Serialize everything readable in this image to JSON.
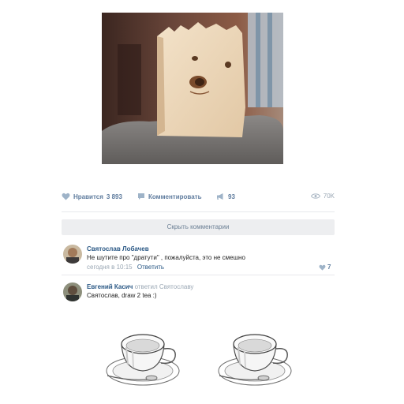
{
  "post": {
    "actions": {
      "like_label": "Нравится",
      "like_count": "3 893",
      "comment_label": "Комментировать",
      "share_count": "93",
      "views": "70K"
    },
    "show_comments_label": "Скрыть комментарии"
  },
  "comments": [
    {
      "author": "Святослав Лобачев",
      "text": "Не шутите про \"дратути\" , пожалуйста, это не смешно",
      "time": "сегодня в 10:15",
      "reply_label": "Ответить",
      "likes": "7"
    },
    {
      "author": "Евгений Касич",
      "replied_to": "ответил Святославу",
      "text": "Святослав, draw 2 tea :)"
    }
  ],
  "icons": {
    "like": "heart-icon",
    "comment": "comment-icon",
    "share": "megaphone-icon",
    "views": "eye-icon"
  },
  "colors": {
    "link": "#2a5885",
    "action": "#5f7c9e",
    "muted": "#9aa7b4",
    "bar": "#edeef0"
  }
}
